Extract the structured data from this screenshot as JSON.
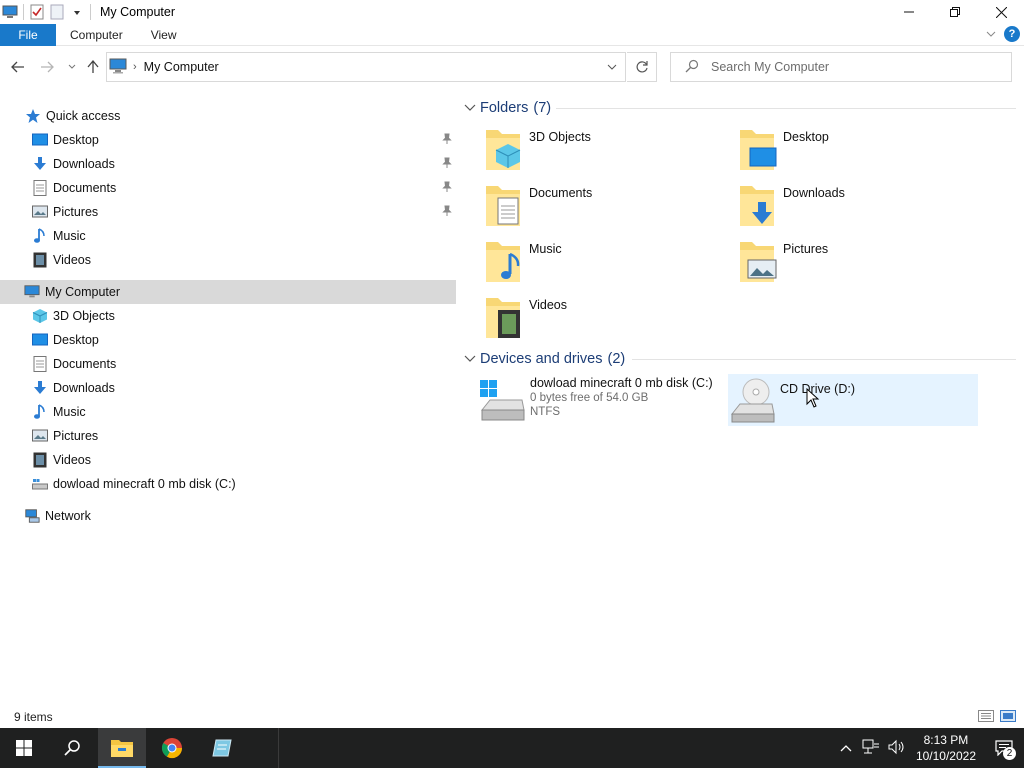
{
  "window": {
    "title": "My Computer",
    "controls": [
      "minimize",
      "restore",
      "close"
    ]
  },
  "ribbon": {
    "file_label": "File",
    "tabs": [
      "Computer",
      "View"
    ]
  },
  "address": {
    "crumb": "My Computer",
    "search_placeholder": "Search My Computer"
  },
  "navpane": {
    "quick_access": "Quick access",
    "quick_items": [
      {
        "label": "Desktop",
        "icon": "desktop-icon",
        "pinned": true
      },
      {
        "label": "Downloads",
        "icon": "downloads-icon",
        "pinned": true
      },
      {
        "label": "Documents",
        "icon": "documents-icon",
        "pinned": true
      },
      {
        "label": "Pictures",
        "icon": "pictures-icon",
        "pinned": true
      },
      {
        "label": "Music",
        "icon": "music-icon",
        "pinned": false
      },
      {
        "label": "Videos",
        "icon": "videos-icon",
        "pinned": false
      }
    ],
    "my_computer": "My Computer",
    "computer_items": [
      {
        "label": "3D Objects",
        "icon": "3d-objects-icon"
      },
      {
        "label": "Desktop",
        "icon": "desktop-icon"
      },
      {
        "label": "Documents",
        "icon": "documents-icon"
      },
      {
        "label": "Downloads",
        "icon": "downloads-icon"
      },
      {
        "label": "Music",
        "icon": "music-icon"
      },
      {
        "label": "Pictures",
        "icon": "pictures-icon"
      },
      {
        "label": "Videos",
        "icon": "videos-icon"
      },
      {
        "label": "dowload minecraft 0 mb disk (C:)",
        "icon": "drive-icon"
      }
    ],
    "network": "Network"
  },
  "content": {
    "folders_title": "Folders",
    "folders_count": "(7)",
    "folders": [
      {
        "name": "3D Objects",
        "icon": "3d-objects-folder-icon"
      },
      {
        "name": "Desktop",
        "icon": "desktop-folder-icon"
      },
      {
        "name": "Documents",
        "icon": "documents-folder-icon"
      },
      {
        "name": "Downloads",
        "icon": "downloads-folder-icon"
      },
      {
        "name": "Music",
        "icon": "music-folder-icon"
      },
      {
        "name": "Pictures",
        "icon": "pictures-folder-icon"
      },
      {
        "name": "Videos",
        "icon": "videos-folder-icon"
      }
    ],
    "drives_title": "Devices and drives",
    "drives_count": "(2)",
    "drives": [
      {
        "name": "dowload minecraft 0 mb disk (C:)",
        "free": "0 bytes free of 54.0 GB",
        "fs": "NTFS",
        "icon": "windows-drive-icon"
      },
      {
        "name": "CD Drive (D:)",
        "icon": "cd-drive-icon"
      }
    ]
  },
  "status": {
    "items": "9 items"
  },
  "taskbar": {
    "time": "8:13 PM",
    "date": "10/10/2022",
    "notifications": "2",
    "colors": {
      "bg": "#1f2020",
      "accent": "#76b9ed"
    }
  },
  "colors": {
    "file_tab": "#1979ca",
    "selection": "#d9d9d9",
    "hover": "#e5f3ff",
    "group_header": "#1c3d76"
  }
}
